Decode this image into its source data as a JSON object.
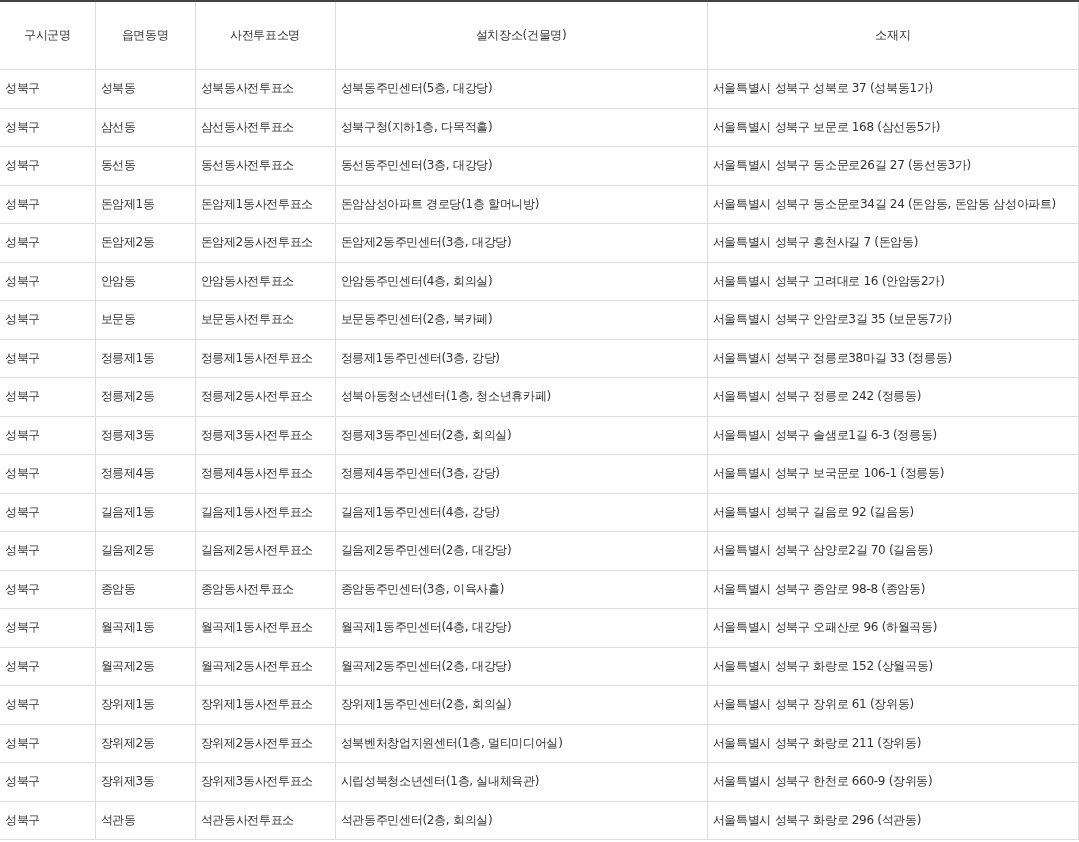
{
  "table": {
    "columns": [
      "구시군명",
      "읍면동명",
      "사전투표소명",
      "설치장소(건물명)",
      "소재지"
    ],
    "rows": [
      [
        "성북구",
        "성북동",
        "성북동사전투표소",
        "성북동주민센터(5층, 대강당)",
        "서울특별시 성북구 성북로 37 (성북동1가)"
      ],
      [
        "성북구",
        "삼선동",
        "삼선동사전투표소",
        "성북구청(지하1층, 다목적홀)",
        "서울특별시 성북구 보문로 168 (삼선동5가)"
      ],
      [
        "성북구",
        "동선동",
        "동선동사전투표소",
        "동선동주민센터(3층, 대강당)",
        "서울특별시 성북구 동소문로26길 27 (동선동3가)"
      ],
      [
        "성북구",
        "돈암제1동",
        "돈암제1동사전투표소",
        "돈암삼성아파트 경로당(1층 할머니방)",
        "서울특별시 성북구 동소문로34길 24 (돈암동, 돈암동 삼성아파트)"
      ],
      [
        "성북구",
        "돈암제2동",
        "돈암제2동사전투표소",
        "돈암제2동주민센터(3층, 대강당)",
        "서울특별시 성북구 흥천사길 7 (돈암동)"
      ],
      [
        "성북구",
        "안암동",
        "안암동사전투표소",
        "안암동주민센터(4층, 회의실)",
        "서울특별시 성북구 고려대로 16 (안암동2가)"
      ],
      [
        "성북구",
        "보문동",
        "보문동사전투표소",
        "보문동주민센터(2층, 북카페)",
        "서울특별시 성북구 안암로3길 35 (보문동7가)"
      ],
      [
        "성북구",
        "정릉제1동",
        "정릉제1동사전투표소",
        "정릉제1동주민센터(3층, 강당)",
        "서울특별시 성북구 정릉로38마길 33 (정릉동)"
      ],
      [
        "성북구",
        "정릉제2동",
        "정릉제2동사전투표소",
        "성북아동청소년센터(1층, 청소년휴카페)",
        "서울특별시 성북구 정릉로 242 (정릉동)"
      ],
      [
        "성북구",
        "정릉제3동",
        "정릉제3동사전투표소",
        "정릉제3동주민센터(2층, 회의실)",
        "서울특별시 성북구 솔샘로1길 6-3 (정릉동)"
      ],
      [
        "성북구",
        "정릉제4동",
        "정릉제4동사전투표소",
        "정릉제4동주민센터(3층, 강당)",
        "서울특별시 성북구 보국문로 106-1 (정릉동)"
      ],
      [
        "성북구",
        "길음제1동",
        "길음제1동사전투표소",
        "길음제1동주민센터(4층, 강당)",
        "서울특별시 성북구 길음로 92 (길음동)"
      ],
      [
        "성북구",
        "길음제2동",
        "길음제2동사전투표소",
        "길음제2동주민센터(2층, 대강당)",
        "서울특별시 성북구 삼양로2길 70 (길음동)"
      ],
      [
        "성북구",
        "종암동",
        "종암동사전투표소",
        "종암동주민센터(3층, 이육사홀)",
        "서울특별시 성북구 종암로 98-8 (종암동)"
      ],
      [
        "성북구",
        "월곡제1동",
        "월곡제1동사전투표소",
        "월곡제1동주민센터(4층, 대강당)",
        "서울특별시 성북구 오패산로 96 (하월곡동)"
      ],
      [
        "성북구",
        "월곡제2동",
        "월곡제2동사전투표소",
        "월곡제2동주민센터(2층, 대강당)",
        "서울특별시 성북구 화랑로 152 (상월곡동)"
      ],
      [
        "성북구",
        "장위제1동",
        "장위제1동사전투표소",
        "장위제1동주민센터(2층, 회의실)",
        "서울특별시 성북구 장위로 61 (장위동)"
      ],
      [
        "성북구",
        "장위제2동",
        "장위제2동사전투표소",
        "성북벤처창업지원센터(1층, 멀티미디어실)",
        "서울특별시 성북구 화랑로 211 (장위동)"
      ],
      [
        "성북구",
        "장위제3동",
        "장위제3동사전투표소",
        "시립성북청소년센터(1층, 실내체육관)",
        "서울특별시 성북구 한천로 660-9 (장위동)"
      ],
      [
        "성북구",
        "석관동",
        "석관동사전투표소",
        "석관동주민센터(2층, 회의실)",
        "서울특별시 성북구 화랑로 296 (석관동)"
      ]
    ]
  }
}
